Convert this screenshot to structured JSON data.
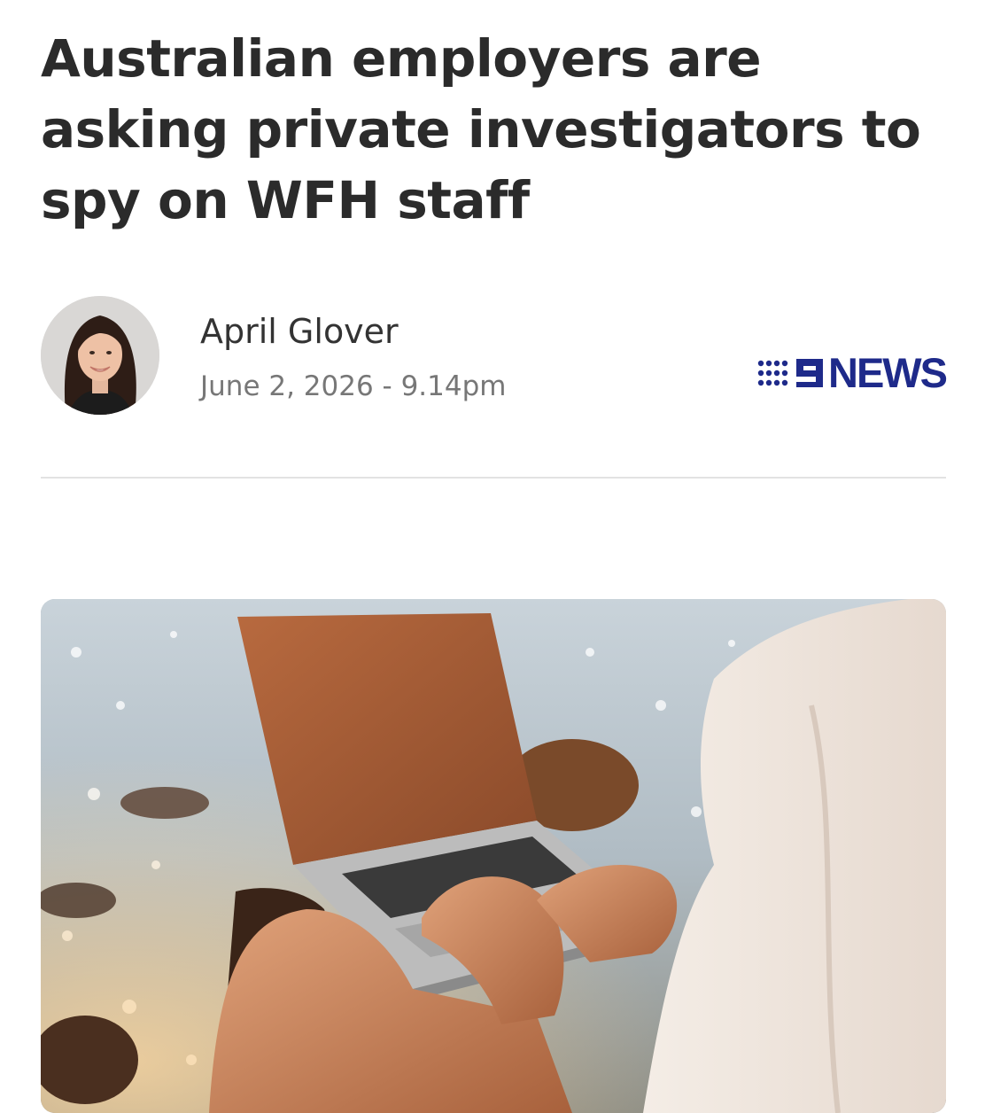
{
  "article": {
    "headline": "Australian employers are asking private investigators to spy on WFH staff",
    "author": "April Glover",
    "published": "June 2, 2026 - 9.14pm",
    "publisher": {
      "logo_icon": "nine-network-logo-icon",
      "logo_mark": "9",
      "logo_word": "NEWS",
      "brand_color": "#1e2a8a"
    },
    "avatar_icon": "author-avatar",
    "hero_image": "person-using-laptop-by-water-photo"
  },
  "colors": {
    "headline": "#2b2b2b",
    "author": "#333333",
    "date": "#777777",
    "divider": "#e2e2e2"
  }
}
